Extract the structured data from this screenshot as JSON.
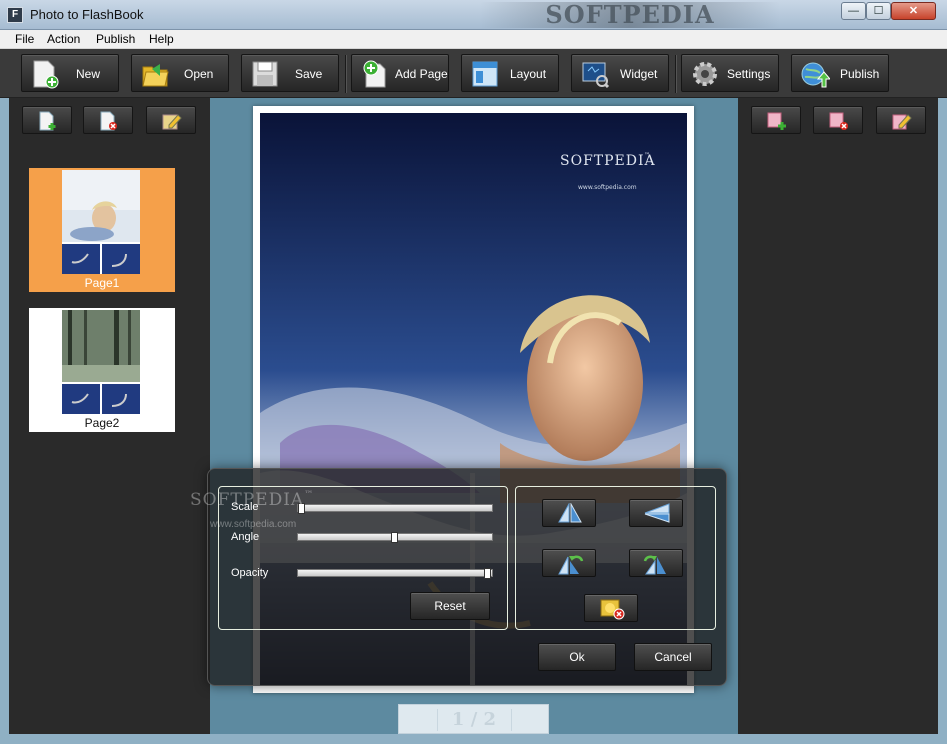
{
  "window": {
    "title": "Photo to FlashBook",
    "watermark": "SOFTPEDIA",
    "min_symbol": "—",
    "max_symbol": "☐",
    "close_symbol": "✕",
    "app_icon": "F"
  },
  "menu": [
    "File",
    "Action",
    "Publish",
    "Help"
  ],
  "toolbar": {
    "new": "New",
    "open": "Open",
    "save": "Save",
    "add_page": "Add Page",
    "layout": "Layout",
    "widget": "Widget",
    "settings": "Settings",
    "publish": "Publish"
  },
  "pages": [
    {
      "label": "Page1",
      "selected": true
    },
    {
      "label": "Page2",
      "selected": false
    }
  ],
  "page_image": {
    "brand": "SOFTPEDIA",
    "brand_tm": "™",
    "url": "www.softpedia.com"
  },
  "pager": {
    "text": "1 / 2"
  },
  "dialog": {
    "watermark": "SOFTPEDIA",
    "watermark_tm": "™",
    "watermark_url": "www.softpedia.com",
    "scale_label": "Scale",
    "scale_value": 0.0,
    "angle_label": "Angle",
    "angle_value": 0.5,
    "opacity_label": "Opacity",
    "opacity_value": 1.0,
    "reset": "Reset",
    "ok": "Ok",
    "cancel": "Cancel"
  }
}
